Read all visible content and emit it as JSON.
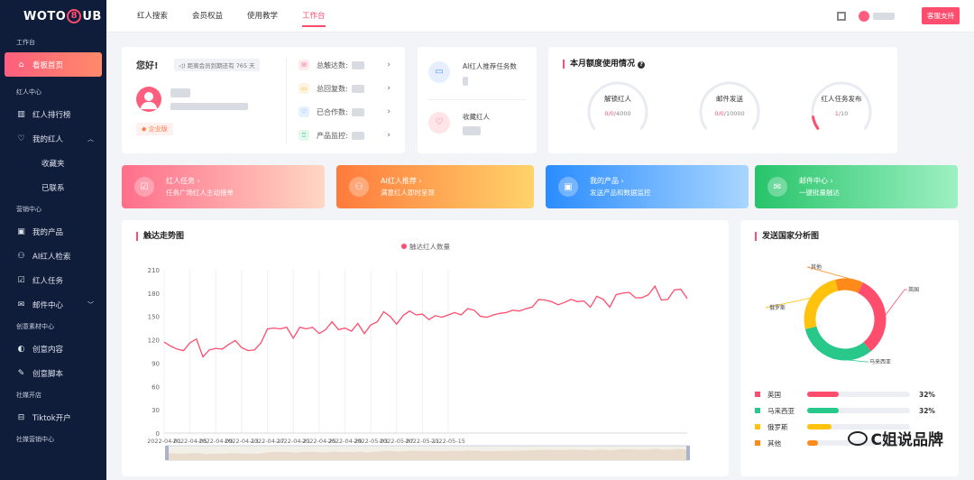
{
  "sidebar": {
    "brand": {
      "left": "WOTO",
      "right": "UB"
    },
    "sections": {
      "workspace": "工作台",
      "influencer": "红人中心",
      "marketing": "营销中心",
      "creative": "创意素材中心",
      "social": "社媒开店",
      "social_marketing": "社媒营销中心"
    },
    "items": {
      "dashboard": "看板首页",
      "ranking": "红人排行榜",
      "my_influencers": "我的红人",
      "favorites": "收藏夹",
      "contacted": "已联系",
      "my_products": "我的产品",
      "ai_search": "AI红人检索",
      "tasks": "红人任务",
      "mail": "邮件中心",
      "creative_content": "创意内容",
      "creative_script": "创意脚本",
      "tiktok": "Tiktok开户"
    }
  },
  "topbar": {
    "nav": [
      "红人搜索",
      "会员权益",
      "使用教学",
      "工作台"
    ],
    "active": "工作台",
    "support_button": "客服支持"
  },
  "greeting": {
    "hello": "您好!",
    "notice": "距离会员到期还有 765 天",
    "tag": "企业版"
  },
  "stats": [
    {
      "label": "总触达数:",
      "color": "#ff5e7e",
      "icon": "✉"
    },
    {
      "label": "总回复数:",
      "color": "#ffb020",
      "icon": "▭"
    },
    {
      "label": "已合作数:",
      "color": "#4a8cff",
      "icon": "♡"
    },
    {
      "label": "产品监控:",
      "color": "#27c87a",
      "icon": "♖"
    }
  ],
  "ai_card": {
    "recommend_label": "AI红人推荐任务数",
    "collect_label": "收藏红人"
  },
  "quota": {
    "title": "本月额度使用情况",
    "gauges": [
      {
        "label": "解锁红人",
        "used": "0",
        "mid": "/0",
        "total": "/4000",
        "fraction": 0,
        "color": "#ff4d6d"
      },
      {
        "label": "邮件发送",
        "used": "0",
        "mid": "/0",
        "total": "/10000",
        "fraction": 0,
        "color": "#ff4d6d"
      },
      {
        "label": "红人任务发布",
        "used": "1",
        "mid": "",
        "total": "/10",
        "fraction": 0.1,
        "color": "#ff4d6d"
      }
    ]
  },
  "banners": [
    {
      "title": "红人任务 ›",
      "sub": "任务广场红人主动接单",
      "from": "#ff6e8a",
      "to": "#ffd7c4",
      "icon": "☑"
    },
    {
      "title": "AI红人推荐 ›",
      "sub": "满意红人即时呈现",
      "from": "#ff7a3c",
      "to": "#ffd36a",
      "icon": "⚇"
    },
    {
      "title": "我的产品 ›",
      "sub": "发送产品和数据监控",
      "from": "#2a8cff",
      "to": "#a9d6ff",
      "icon": "▣"
    },
    {
      "title": "邮件中心 ›",
      "sub": "一键批量触达",
      "from": "#27c46a",
      "to": "#9ef0c2",
      "icon": "✉"
    }
  ],
  "trend": {
    "title": "触达走势图",
    "legend": "触达红人数量"
  },
  "chart_data": {
    "type": "line",
    "title": "触达走势图",
    "series": [
      {
        "name": "触达红人数量",
        "color": "#ff4d6d",
        "values": [
          117,
          112,
          108,
          106,
          116,
          121,
          98,
          107,
          109,
          108,
          114,
          119,
          110,
          106,
          107,
          116,
          134,
          135,
          134,
          136,
          122,
          136,
          134,
          136,
          128,
          133,
          143,
          133,
          135,
          131,
          141,
          128,
          139,
          143,
          156,
          150,
          140,
          151,
          157,
          152,
          153,
          146,
          151,
          149,
          152,
          155,
          152,
          160,
          158,
          150,
          149,
          152,
          154,
          155,
          158,
          157,
          160,
          162,
          172,
          171,
          169,
          165,
          168,
          172,
          169,
          170,
          162,
          176,
          172,
          162,
          178,
          180,
          181,
          174,
          174,
          178,
          189,
          171,
          172,
          184,
          185,
          173
        ]
      }
    ],
    "x_ticks": [
      "2022-04-01",
      "2022-04-05",
      "2022-04-09",
      "2022-04-13",
      "2022-04-17",
      "2022-04-21",
      "2022-04-25",
      "2022-04-29",
      "2022-05-03",
      "2022-05-07",
      "2022-05-11",
      "2022-05-15"
    ],
    "ylim": [
      0,
      210
    ],
    "yticks": [
      0,
      30,
      60,
      90,
      120,
      150,
      180,
      210
    ],
    "grid": "vertical",
    "legend": "top-center"
  },
  "country": {
    "title": "发送国家分析图",
    "items": [
      {
        "name": "英国",
        "pct": "32%",
        "value": 32,
        "color": "#ff4d6d"
      },
      {
        "name": "马来西亚",
        "pct": "32%",
        "value": 32,
        "color": "#27c88a"
      },
      {
        "name": "俄罗斯",
        "pct": "",
        "value": 25,
        "color": "#ffc20e"
      },
      {
        "name": "其他",
        "pct": "",
        "value": 11,
        "color": "#ff8a1a"
      }
    ]
  },
  "watermark": "C姐说品牌"
}
